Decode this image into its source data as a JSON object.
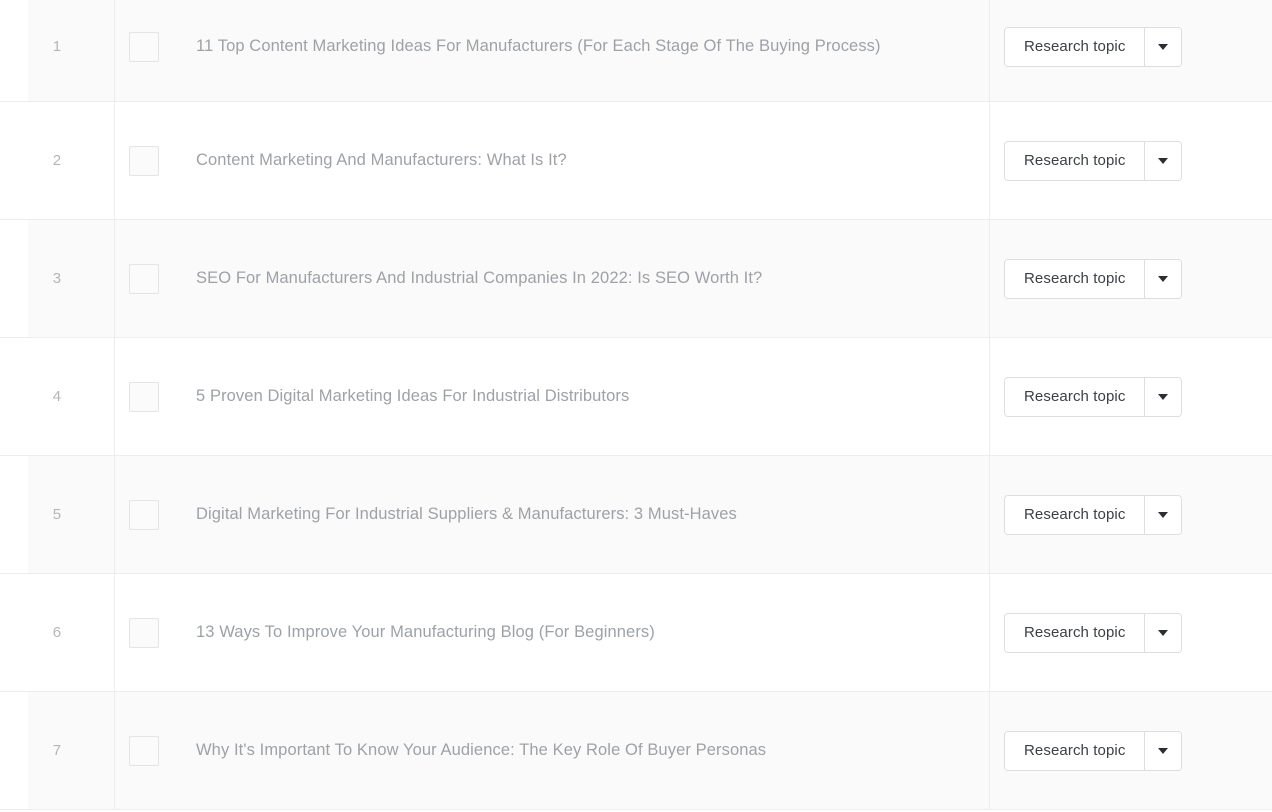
{
  "table": {
    "action_label": "Research topic",
    "dropdown_icon": "chevron-down-icon",
    "checkbox_icon": "checkbox-unchecked-icon",
    "colors": {
      "row_stripe": "#fafafa",
      "row_base": "#ffffff",
      "row_divider": "#eceded",
      "title_text": "#9ea2a6",
      "index_text": "#b3b6b8",
      "button_text": "#3c4043",
      "button_border": "#dcdedf",
      "caret": "#2b2f33"
    },
    "rows": [
      {
        "index": "1",
        "title": "11 Top Content Marketing Ideas For Manufacturers (For Each Stage Of The Buying Process)",
        "action": "Research topic",
        "checked": false
      },
      {
        "index": "2",
        "title": "Content Marketing And Manufacturers: What Is It?",
        "action": "Research topic",
        "checked": false
      },
      {
        "index": "3",
        "title": "SEO For Manufacturers And Industrial Companies In 2022: Is SEO Worth It?",
        "action": "Research topic",
        "checked": false
      },
      {
        "index": "4",
        "title": "5 Proven Digital Marketing Ideas For Industrial Distributors",
        "action": "Research topic",
        "checked": false
      },
      {
        "index": "5",
        "title": "Digital Marketing For Industrial Suppliers & Manufacturers: 3 Must-Haves",
        "action": "Research topic",
        "checked": false
      },
      {
        "index": "6",
        "title": "13 Ways To Improve Your Manufacturing Blog (For Beginners)",
        "action": "Research topic",
        "checked": false
      },
      {
        "index": "7",
        "title": "Why It's Important To Know Your Audience: The Key Role Of Buyer Personas",
        "action": "Research topic",
        "checked": false
      }
    ]
  }
}
